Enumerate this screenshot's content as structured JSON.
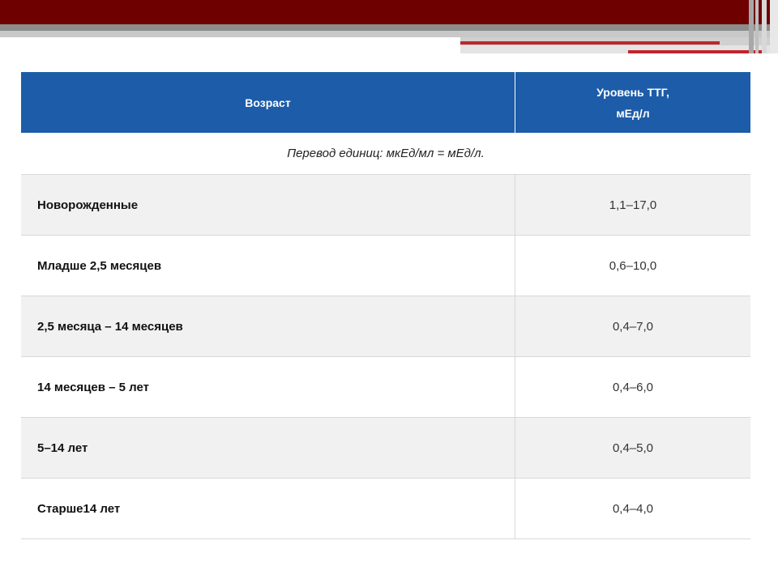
{
  "table": {
    "header": {
      "age": "Возраст",
      "tsh_line1": "Уровень ТТГ,",
      "tsh_line2": "мЕд/л"
    },
    "note": "Перевод единиц: мкЕд/мл = мЕд/л.",
    "rows": [
      {
        "age": "Новорожденные",
        "value": "1,1–17,0"
      },
      {
        "age": "Младше 2,5 месяцев",
        "value": "0,6–10,0"
      },
      {
        "age": "2,5 месяца – 14 месяцев",
        "value": "0,4–7,0"
      },
      {
        "age": "14 месяцев – 5 лет",
        "value": "0,4–6,0"
      },
      {
        "age": "5–14 лет",
        "value": "0,4–5,0"
      },
      {
        "age": "Старше14 лет",
        "value": "0,4–4,0"
      }
    ]
  },
  "colors": {
    "header_bg": "#1d5ca8",
    "banner_dark": "#6e0000",
    "accent_red": "#c0262b"
  }
}
